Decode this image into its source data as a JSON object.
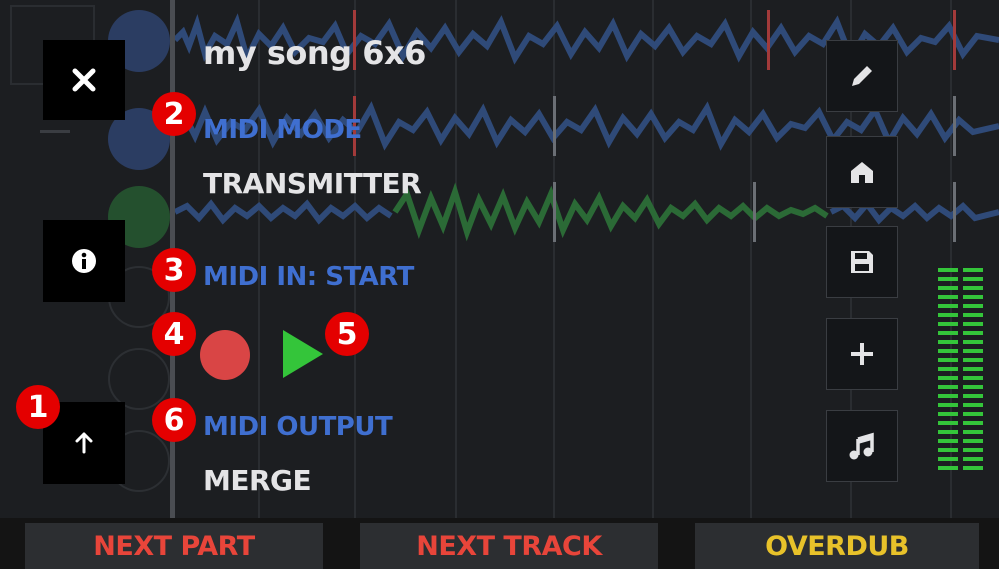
{
  "song": {
    "title": "my song 6x6"
  },
  "settings": {
    "midi_mode_label": "MIDI MODE",
    "midi_mode_value": "TRANSMITTER",
    "midi_in_label": "MIDI IN: START",
    "midi_output_label": "MIDI OUTPUT",
    "midi_output_value": "MERGE"
  },
  "left_buttons": {
    "close": "close-icon",
    "info": "info-icon",
    "up": "arrow-up-icon"
  },
  "right_buttons": [
    "pencil-icon",
    "home-icon",
    "save-icon",
    "plus-icon",
    "music-note-icon"
  ],
  "callouts": [
    "1",
    "2",
    "3",
    "4",
    "5",
    "6"
  ],
  "bottom_bar": {
    "next_part": "NEXT PART",
    "next_track": "NEXT TRACK",
    "overdub": "OVERDUB"
  },
  "colors": {
    "accent_blue": "#3f6fd0",
    "record_red": "#d94545",
    "play_green": "#34c53a",
    "next_label_red": "#e8453a",
    "overdub_yellow": "#e8c22a",
    "callout_red": "#e40000"
  }
}
